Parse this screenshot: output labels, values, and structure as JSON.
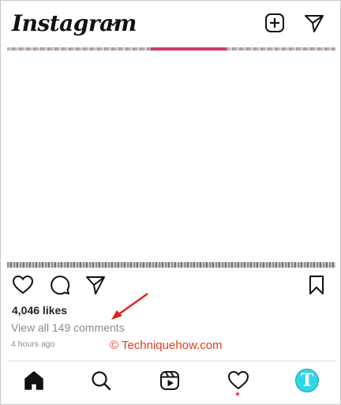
{
  "header": {
    "logo_text": "Instagram",
    "icons": [
      "chevron-down-icon",
      "add-post-icon",
      "direct-message-icon"
    ]
  },
  "post": {
    "likes": "4,046 likes",
    "view_comments": "View all 149 comments",
    "timestamp": "4 hours ago",
    "actions": [
      "heart-icon",
      "comment-icon",
      "share-icon",
      "bookmark-icon"
    ]
  },
  "overlay": {
    "watermark": "© Techniquehow.com",
    "arrow_color": "#e0201b"
  },
  "bottom_nav": {
    "items": [
      "home-icon",
      "search-icon",
      "reels-icon",
      "activity-heart-icon",
      "profile-avatar"
    ],
    "avatar_letter": "T",
    "avatar_color": "#2ed6e6",
    "notification_dot_color": "#ff3040"
  }
}
